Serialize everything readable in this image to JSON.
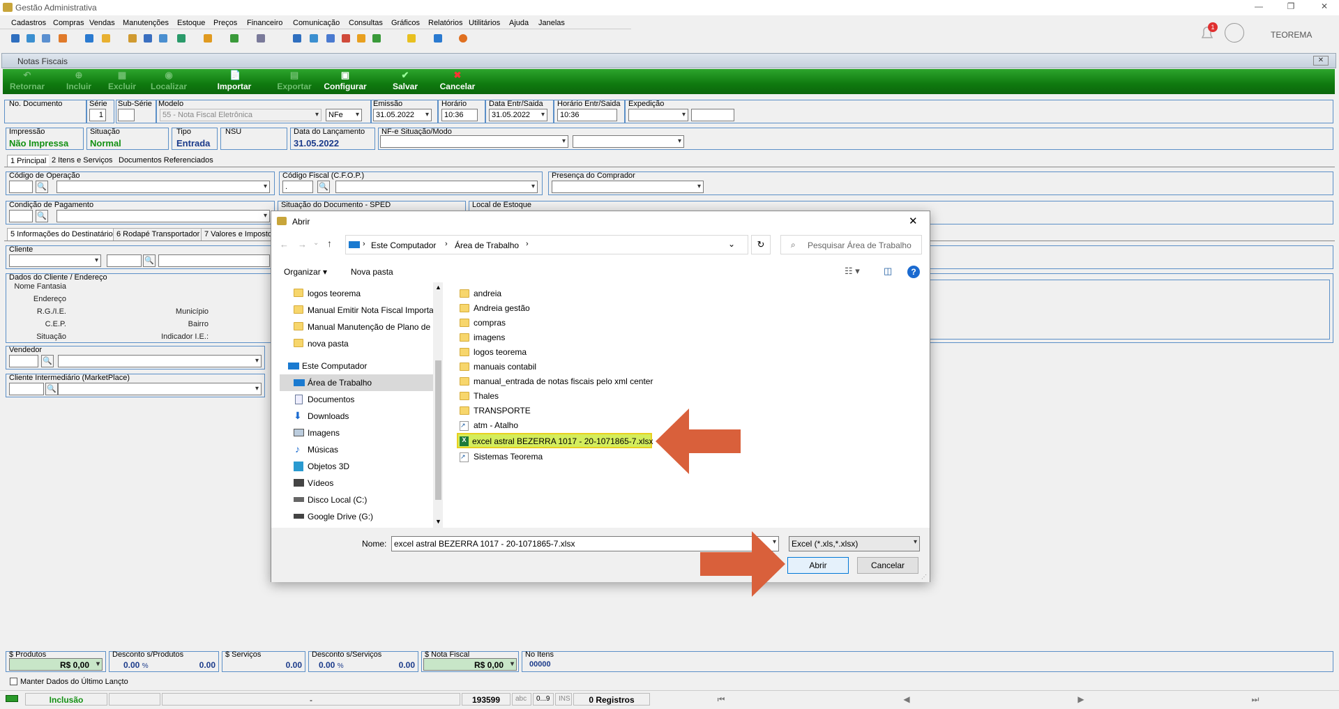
{
  "app": {
    "title": "Gestão Administrativa",
    "user": "TEOREMA",
    "notifications": "1"
  },
  "menu": [
    "Cadastros",
    "Compras",
    "Vendas",
    "Manutenções",
    "Estoque",
    "Preços",
    "Financeiro",
    "Comunicação",
    "Consultas",
    "Gráficos",
    "Relatórios",
    "Utilitários",
    "Ajuda",
    "Janelas"
  ],
  "window": {
    "title": "Notas Fiscais"
  },
  "actions": {
    "retornar": "Retornar",
    "incluir": "Incluir",
    "excluir": "Excluir",
    "localizar": "Localizar",
    "importar": "Importar",
    "exportar": "Exportar",
    "configurar": "Configurar",
    "salvar": "Salvar",
    "cancelar": "Cancelar"
  },
  "header": {
    "no_documento": "No. Documento",
    "serie": "Série",
    "serie_val": "1",
    "sub_serie": "Sub-Série",
    "modelo": "Modelo",
    "modelo_val": "55 - Nota Fiscal Eletrônica",
    "nfe_val": "NFe",
    "emissao": "Emissão",
    "emissao_val": "31.05.2022",
    "horario": "Horário",
    "horario_val": "10:36",
    "data_entr": "Data Entr/Saida",
    "data_entr_val": "31.05.2022",
    "horario_entr": "Horário Entr/Saida",
    "horario_entr_val": "10:36",
    "expedicao": "Expedição",
    "impressao": "Impressão",
    "impressao_val": "Não Impressa",
    "situacao": "Situação",
    "situacao_val": "Normal",
    "tipo": "Tipo",
    "tipo_val": "Entrada",
    "nsu": "NSU",
    "data_lanc": "Data do Lançamento",
    "data_lanc_val": "31.05.2022",
    "nfe_sit": "NF-e Situação/Modo"
  },
  "tabs1": [
    "1 Principal",
    "2 Itens e Serviços",
    "Documentos Referenciados"
  ],
  "principal": {
    "cod_operacao": "Código de Operação",
    "cfop": "Código Fiscal (C.F.O.P.)",
    "presenca": "Presença do Comprador",
    "cond_pag": "Condição de Pagamento",
    "sit_sped": "Situação do Documento - SPED",
    "local_estoque": "Local de Estoque",
    "cfop_val": "."
  },
  "tabs2": [
    "5 Informações do Destinatário",
    "6 Rodapé Transportador",
    "7 Valores e Impostos"
  ],
  "dest": {
    "cliente": "Cliente",
    "dados": "Dados do Cliente / Endereço",
    "nome_fantasia": "Nome Fantasia",
    "endereco": "Endereço",
    "rg_ie": "R.G./I.E.",
    "cep": "C.E.P.",
    "situacao": "Situação",
    "municipio": "Município",
    "bairro": "Bairro",
    "indicador_ie": "Indicador I.E.:",
    "vendedor": "Vendedor",
    "intermediario": "Cliente Intermediário (MarketPlace)"
  },
  "dialog": {
    "title": "Abrir",
    "path": [
      "Este Computador",
      "Área de Trabalho"
    ],
    "search_placeholder": "Pesquisar Área de Trabalho",
    "organizar": "Organizar",
    "nova_pasta": "Nova pasta",
    "nav": [
      "logos teorema",
      "Manual Emitir Nota Fiscal Importa",
      "Manual Manutenção de Plano de",
      "nova pasta",
      "Este Computador",
      "Área de Trabalho",
      "Documentos",
      "Downloads",
      "Imagens",
      "Músicas",
      "Objetos 3D",
      "Vídeos",
      "Disco Local (C:)",
      "Google Drive (G:)"
    ],
    "files": [
      "andreia",
      "Andreia gestão",
      "compras",
      "imagens",
      "logos teorema",
      "manuais contabil",
      "manual_entrada de notas fiscais pelo xml center",
      "Thales",
      "TRANSPORTE",
      "atm - Atalho",
      "excel astral BEZERRA 1017 - 20-1071865-7.xlsx",
      "Sistemas Teorema"
    ],
    "nome_label": "Nome:",
    "nome_val": "excel astral BEZERRA 1017 - 20-1071865-7.xlsx",
    "filter": "Excel (*.xls,*.xlsx)",
    "abrir": "Abrir",
    "cancelar": "Cancelar"
  },
  "totals": {
    "produtos": "$ Produtos",
    "produtos_val": "R$ 0,00",
    "desc_prod": "Desconto s/Produtos",
    "desc_prod_pct": "0.00",
    "desc_prod_val": "0.00",
    "servicos": "$ Serviços",
    "servicos_val": "0.00",
    "desc_serv": "Desconto s/Serviços",
    "desc_serv_pct": "0.00",
    "desc_serv_val": "0.00",
    "nota": "$ Nota Fiscal",
    "nota_val": "R$ 0,00",
    "no_itens": "No Itens",
    "no_itens_val": "00000",
    "pct": "%"
  },
  "manter": "Manter Dados do Último Lançto",
  "status": {
    "mode": "Inclusão",
    "dash": "-",
    "num": "193599",
    "abc": "abc",
    "range": "0...9",
    "ins": "INS",
    "registros": "0 Registros"
  },
  "colors": {
    "green": "#139013",
    "highlight": "#d4ed5c",
    "arrow": "#d9603b"
  }
}
